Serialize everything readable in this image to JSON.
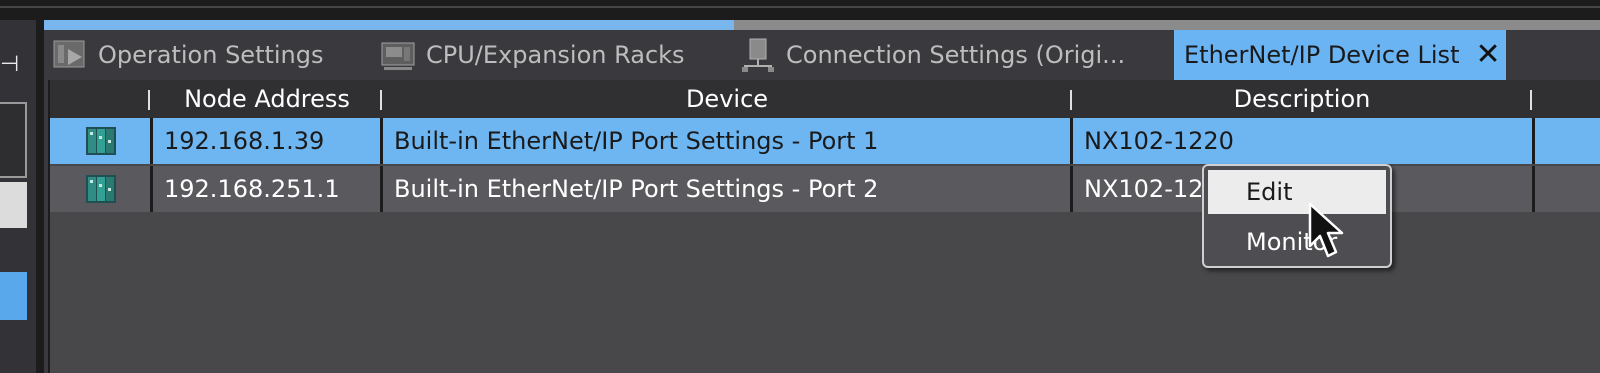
{
  "tabs": [
    {
      "label": "Operation Settings",
      "icon": "operation-settings-icon",
      "active": false
    },
    {
      "label": "CPU/Expansion Racks",
      "icon": "cpu-rack-icon",
      "active": false
    },
    {
      "label": "Connection Settings (Origi...",
      "icon": "connection-settings-icon",
      "active": false
    },
    {
      "label": "EtherNet/IP Device List",
      "icon": "",
      "active": true
    }
  ],
  "table": {
    "columns": [
      "Node Address",
      "Device",
      "Description"
    ],
    "rows": [
      {
        "node": "192.168.1.39",
        "device": "Built-in EtherNet/IP Port Settings - Port 1",
        "description": "NX102-1220",
        "selected": true
      },
      {
        "node": "192.168.251.1",
        "device": "Built-in EtherNet/IP Port Settings - Port 2",
        "description": "NX102-1220",
        "selected": false
      }
    ]
  },
  "context_menu": {
    "items": [
      {
        "label": "Edit",
        "hovered": true
      },
      {
        "label": "Monitor",
        "hovered": false
      }
    ]
  },
  "colors": {
    "selection": "#6eb6f2",
    "active_tab": "#6ab4f4",
    "background": "#3a3a3e"
  }
}
